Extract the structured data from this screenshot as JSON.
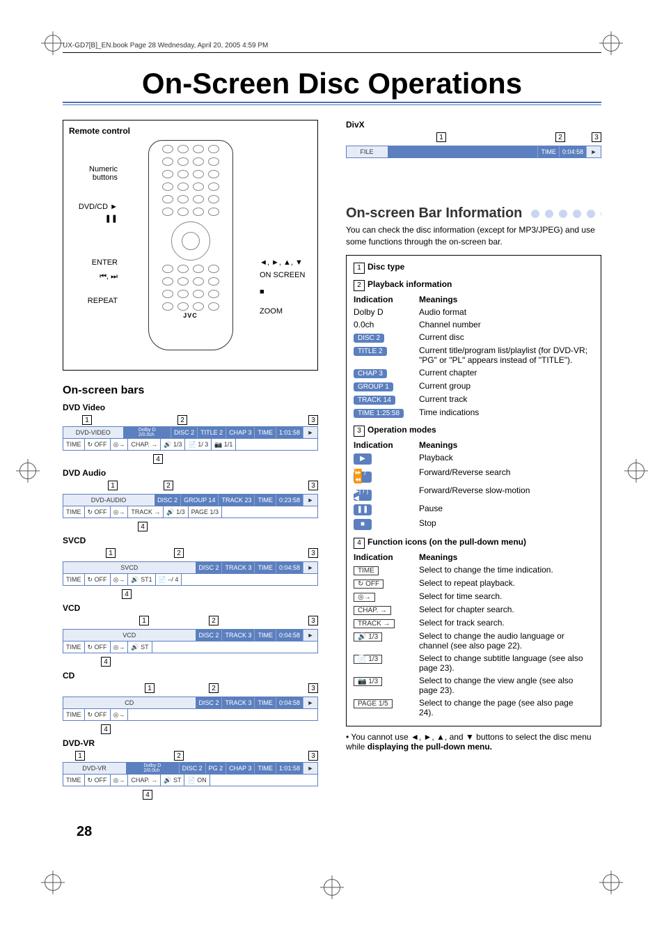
{
  "meta": {
    "header_line": "UX-GD7[B]_EN.book  Page 28  Wednesday, April 20, 2005  4:59 PM"
  },
  "title": "On-Screen Disc Operations",
  "page_number": "28",
  "remote": {
    "box_label": "Remote control",
    "callouts_left": {
      "numeric": "Numeric\nbuttons",
      "dvdcd": "DVD/CD ►",
      "pause": "❚❚",
      "enter": "ENTER",
      "skip": "⏮, ⏭",
      "repeat": "REPEAT"
    },
    "callouts_right": {
      "arrows": "◄, ►, ▲, ▼",
      "onscreen": "ON SCREEN",
      "stop": "■",
      "zoom": "ZOOM"
    },
    "brand": "JVC"
  },
  "bars": {
    "section_title": "On-screen bars",
    "dvd_video": {
      "label": "DVD Video",
      "row1": [
        "DVD-VIDEO",
        "Dolby D\n2/0.0ch",
        "DISC 2",
        "TITLE  2",
        "CHAP  3",
        "TIME",
        "1:01:58",
        "►"
      ],
      "row2": [
        "TIME",
        "↻ OFF",
        "◎→",
        "CHAP. →",
        "🔊 1/3",
        "📄 1/ 3",
        "📷 1/1"
      ]
    },
    "dvd_audio": {
      "label": "DVD Audio",
      "row1": [
        "DVD-AUDIO",
        "DISC 2",
        "GROUP 14",
        "TRACK 23",
        "TIME",
        "0:23:58",
        "►"
      ],
      "row2": [
        "TIME",
        "↻ OFF",
        "◎→",
        "TRACK →",
        "🔊 1/3",
        "PAGE 1/3"
      ]
    },
    "svcd": {
      "label": "SVCD",
      "row1": [
        "SVCD",
        "DISC 2",
        "TRACK  3",
        "TIME",
        "0:04:58",
        "►"
      ],
      "row2": [
        "TIME",
        "↻ OFF",
        "◎→",
        "🔊 ST1",
        "📄 –/ 4"
      ]
    },
    "vcd": {
      "label": "VCD",
      "row1": [
        "VCD",
        "DISC 2",
        "TRACK  3",
        "TIME",
        "0:04:58",
        "►"
      ],
      "row2": [
        "TIME",
        "↻ OFF",
        "◎→",
        "🔊 ST"
      ]
    },
    "cd": {
      "label": "CD",
      "row1": [
        "CD",
        "DISC 2",
        "TRACK  3",
        "TIME",
        "0:04:58",
        "►"
      ],
      "row2": [
        "TIME",
        "↻ OFF",
        "◎→"
      ]
    },
    "dvd_vr": {
      "label": "DVD-VR",
      "row1": [
        "DVD-VR",
        "Dolby D\n2/0.0ch",
        "DISC 2",
        "PG  2",
        "CHAP  3",
        "TIME",
        "1:01:58",
        "►"
      ],
      "row2": [
        "TIME",
        "↻ OFF",
        "◎→",
        "CHAP. →",
        "🔊 ST",
        "📄 ON"
      ]
    },
    "markers": {
      "n1": "1",
      "n2": "2",
      "n3": "3",
      "n4": "4"
    }
  },
  "divx": {
    "label": "DivX",
    "row1": [
      "FILE",
      "TIME",
      "0:04:58",
      "►"
    ],
    "markers": {
      "n1": "1",
      "n2": "2",
      "n3": "3"
    }
  },
  "right": {
    "subheading": "On-screen Bar Information",
    "intro": "You can check the disc information (except for MP3/JPEG) and use some functions through the on-screen bar.",
    "s1_title": "Disc type",
    "s2_title": "Playback information",
    "s2": {
      "h_ind": "Indication",
      "h_mean": "Meanings",
      "rows": [
        {
          "ind": "Dolby D",
          "mean": "Audio format",
          "type": "text"
        },
        {
          "ind": "0.0ch",
          "mean": "Channel number",
          "type": "text"
        },
        {
          "ind": "DISC 2",
          "mean": "Current disc",
          "type": "chip"
        },
        {
          "ind": "TITLE  2",
          "mean": "Current title/program list/playlist (for DVD-VR; \"PG\" or \"PL\" appears instead of \"TITLE\").",
          "type": "chip"
        },
        {
          "ind": "CHAP  3",
          "mean": "Current chapter",
          "type": "chip"
        },
        {
          "ind": "GROUP 1",
          "mean": "Current group",
          "type": "chip"
        },
        {
          "ind": "TRACK 14",
          "mean": "Current track",
          "type": "chip"
        },
        {
          "ind": "TIME 1:25:58",
          "mean": "Time indications",
          "type": "chip"
        }
      ]
    },
    "s3_title": "Operation modes",
    "s3": {
      "h_ind": "Indication",
      "h_mean": "Meanings",
      "rows": [
        {
          "icon": "▶",
          "mean": "Playback"
        },
        {
          "icon": "⏩ / ⏪",
          "mean": "Forward/Reverse search"
        },
        {
          "icon": "▶| / |◀",
          "mean": "Forward/Reverse slow-motion"
        },
        {
          "icon": "❚❚",
          "mean": "Pause"
        },
        {
          "icon": "■",
          "mean": "Stop"
        }
      ]
    },
    "s4_title": "Function icons (on the pull-down menu)",
    "s4": {
      "h_ind": "Indication",
      "h_mean": "Meanings",
      "rows": [
        {
          "ind": "TIME",
          "mean": "Select to change the time indication."
        },
        {
          "ind": "↻ OFF",
          "mean": "Select to repeat playback."
        },
        {
          "ind": "◎→",
          "mean": "Select for time search."
        },
        {
          "ind": "CHAP. →",
          "mean": "Select for chapter search."
        },
        {
          "ind": "TRACK →",
          "mean": "Select for track search."
        },
        {
          "ind": "🔊 1/3",
          "mean": "Select to change the audio language or channel (see also page 22)."
        },
        {
          "ind": "📄  1/3",
          "mean": "Select to change subtitle language (see also page 23)."
        },
        {
          "ind": "📷 1/3",
          "mean": "Select to change the view angle (see also page 23)."
        },
        {
          "ind": "PAGE 1/5",
          "mean": "Select to change the page (see also page 24)."
        }
      ]
    },
    "footnote_pre": "• You cannot use ◄, ►, ▲, and ▼ buttons to select the disc menu while ",
    "footnote_bold": "displaying the pull-down menu."
  }
}
